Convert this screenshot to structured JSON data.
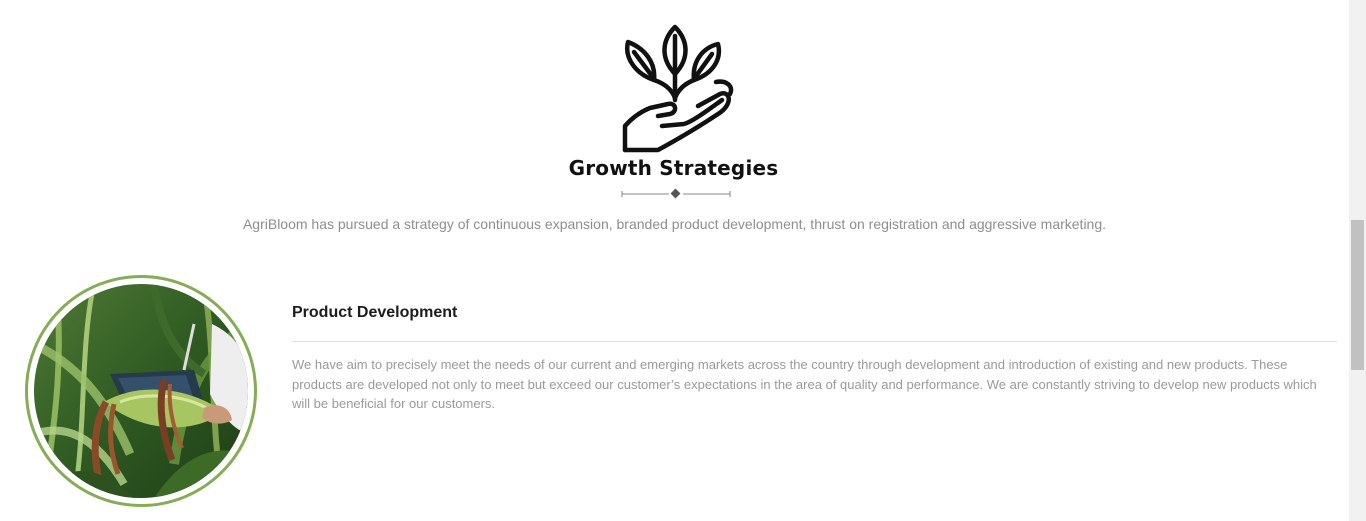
{
  "section": {
    "logo_icon": "plant-in-hand-icon",
    "title": "Growth Strategies",
    "intro": "AgriBloom has pursued a strategy of continuous expansion, branded product development, thrust on registration and aggressive marketing."
  },
  "feature": {
    "image_icon": "cornfield-inspection-photo",
    "heading": "Product Development",
    "body": "We have aim to precisely meet the needs of our current and emerging markets across the country through development and introduction of existing and new products. These products are developed not only to meet but exceed our customer’s expectations in the area of quality and performance. We are constantly striving to develop new products which will be beneficial for our customers."
  },
  "colors": {
    "accent_ring": "#86ac55",
    "body_text": "#9a9a9a",
    "heading_text": "#1c1c1c"
  }
}
